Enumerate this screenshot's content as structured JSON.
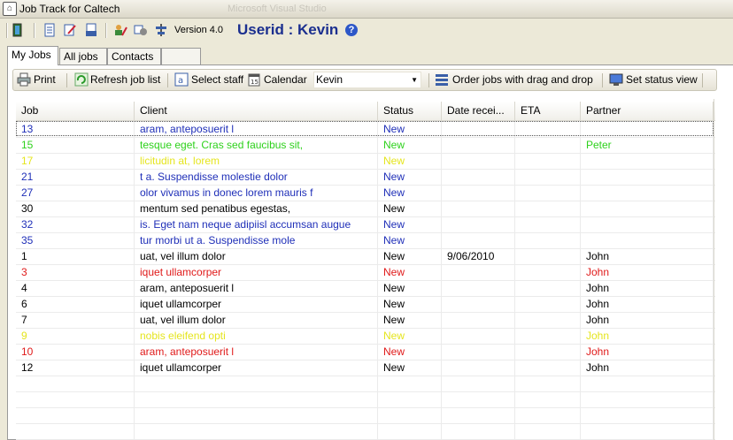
{
  "window": {
    "title": "Job Track for Caltech",
    "faded_title": "Microsoft Visual Studio"
  },
  "main_toolbar": {
    "version": "Version 4.0",
    "userid": "Userid : Kevin"
  },
  "tabs": [
    {
      "label": "My Jobs",
      "active": true
    },
    {
      "label": "All jobs",
      "active": false
    },
    {
      "label": "Contacts",
      "active": false
    },
    {
      "label": "",
      "active": false
    }
  ],
  "sub_toolbar": {
    "print": "Print",
    "refresh": "Refresh job list",
    "select_staff": "Select staff",
    "calendar": "Calendar",
    "staff_value": "Kevin",
    "order_jobs": "Order jobs with drag and drop",
    "status_view": "Set status view"
  },
  "grid": {
    "columns": [
      "Job",
      "Client",
      "Status",
      "Date recei...",
      "ETA",
      "Partner"
    ],
    "rows": [
      {
        "job": "13",
        "client": "aram, anteposuerit l",
        "status": "New",
        "date": "",
        "eta": "",
        "partner": "",
        "color": "blue"
      },
      {
        "job": "15",
        "client": "tesque eget. Cras sed faucibus sit,",
        "status": "New",
        "date": "",
        "eta": "",
        "partner": "Peter",
        "color": "green"
      },
      {
        "job": "17",
        "client": "licitudin at, lorem",
        "status": "New",
        "date": "",
        "eta": "",
        "partner": "",
        "color": "yellow"
      },
      {
        "job": "21",
        "client": "t a. Suspendisse molestie dolor",
        "status": "New",
        "date": "",
        "eta": "",
        "partner": "",
        "color": "blue"
      },
      {
        "job": "27",
        "client": "olor vivamus in donec lorem mauris f",
        "status": "New",
        "date": "",
        "eta": "",
        "partner": "",
        "color": "blue"
      },
      {
        "job": "30",
        "client": "mentum sed penatibus egestas,",
        "status": "New",
        "date": "",
        "eta": "",
        "partner": "",
        "color": "black"
      },
      {
        "job": "32",
        "client": "is. Eget nam neque adipiisl accumsan augue",
        "status": "New",
        "date": "",
        "eta": "",
        "partner": "",
        "color": "blue"
      },
      {
        "job": "35",
        "client": "tur morbi ut a. Suspendisse mole",
        "status": "New",
        "date": "",
        "eta": "",
        "partner": "",
        "color": "blue"
      },
      {
        "job": "1",
        "client": "uat, vel illum dolor",
        "status": "New",
        "date": "9/06/2010",
        "eta": "",
        "partner": "John",
        "color": "black"
      },
      {
        "job": "3",
        "client": "iquet ullamcorper",
        "status": "New",
        "date": "",
        "eta": "",
        "partner": "John",
        "color": "red"
      },
      {
        "job": "4",
        "client": "aram, anteposuerit l",
        "status": "New",
        "date": "",
        "eta": "",
        "partner": "John",
        "color": "black"
      },
      {
        "job": "6",
        "client": "iquet ullamcorper",
        "status": "New",
        "date": "",
        "eta": "",
        "partner": "John",
        "color": "black"
      },
      {
        "job": "7",
        "client": "uat, vel illum dolor",
        "status": "New",
        "date": "",
        "eta": "",
        "partner": "John",
        "color": "black"
      },
      {
        "job": "9",
        "client": " nobis eleifend opti",
        "status": "New",
        "date": "",
        "eta": "",
        "partner": "John",
        "color": "yellow"
      },
      {
        "job": "10",
        "client": "aram, anteposuerit l",
        "status": "New",
        "date": "",
        "eta": "",
        "partner": "John",
        "color": "red"
      },
      {
        "job": "12",
        "client": "iquet ullamcorper",
        "status": "New",
        "date": "",
        "eta": "",
        "partner": "John",
        "color": "black"
      }
    ]
  },
  "colors": {
    "blue": "#1f2fb8",
    "green": "#2ed11c",
    "yellow": "#e5e51e",
    "red": "#e01a1a",
    "userid": "#1b2f8f"
  }
}
